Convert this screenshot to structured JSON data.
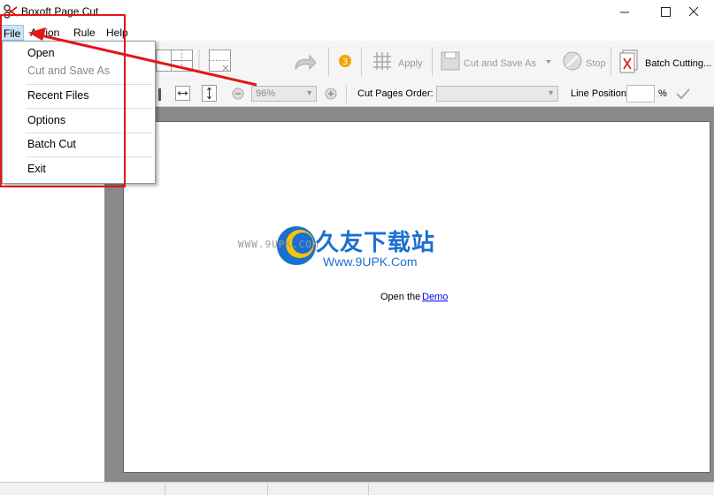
{
  "window": {
    "title": "Boxoft Page Cut",
    "minimize_icon": "minimize-icon",
    "maximize_icon": "maximize-icon",
    "close_icon": "close-icon"
  },
  "menubar": {
    "items": [
      "File",
      "Action",
      "Rule",
      "Help"
    ]
  },
  "file_menu": {
    "items": [
      {
        "label": "Open",
        "enabled": true
      },
      {
        "label": "Cut and Save As",
        "enabled": false
      },
      {
        "label": "Recent Files",
        "enabled": true
      },
      {
        "label": "Options",
        "enabled": true
      },
      {
        "label": "Batch Cut",
        "enabled": true
      },
      {
        "label": "Exit",
        "enabled": true
      }
    ]
  },
  "toolbar": {
    "apply_label": "Apply",
    "cut_save_label": "Cut and Save As",
    "stop_label": "Stop",
    "batch_label": "Batch Cutting..."
  },
  "toolbar2": {
    "zoom_value": "96%",
    "cut_order_label": "Cut Pages Order:",
    "cut_order_value": "",
    "line_position_label": "Line Position:",
    "line_position_value": "",
    "percent_sign": "%"
  },
  "document": {
    "open_text": "Open the",
    "demo_link": "Demo",
    "watermark_cn": "久友下载站",
    "watermark_url": "Www.9UPK.Com",
    "watermark_left": "WWW.9UPK.COM"
  },
  "colors": {
    "annotation_red": "#e01818",
    "link_blue": "#0000ee",
    "watermark_blue": "#1c6fd1"
  }
}
